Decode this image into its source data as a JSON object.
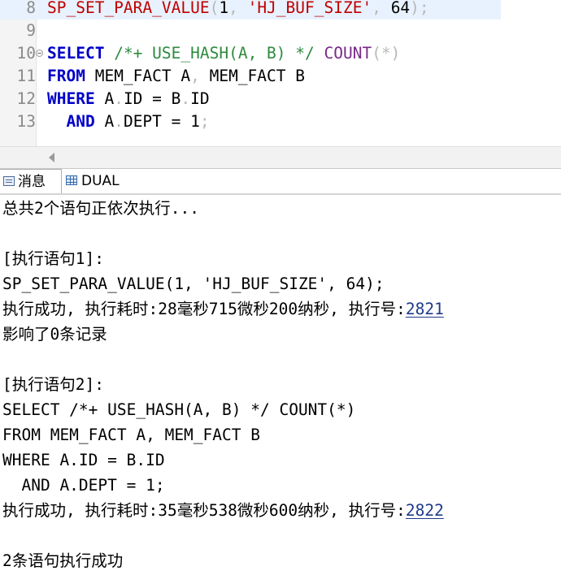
{
  "editor": {
    "lines": [
      {
        "number": "8",
        "highlighted": true,
        "tokens": [
          {
            "text": "SP_SET_PARA_VALUE",
            "cls": "str"
          },
          {
            "text": "(",
            "cls": "dim"
          },
          {
            "text": "1",
            "cls": ""
          },
          {
            "text": ", ",
            "cls": "dim"
          },
          {
            "text": "'HJ_BUF_SIZE'",
            "cls": "str"
          },
          {
            "text": ", ",
            "cls": "dim"
          },
          {
            "text": "64",
            "cls": ""
          },
          {
            "text": ");",
            "cls": "dim"
          }
        ]
      },
      {
        "number": "9",
        "tokens": []
      },
      {
        "number": "10",
        "fold": true,
        "tokens": [
          {
            "text": "SELECT",
            "cls": "kw"
          },
          {
            "text": " ",
            "cls": ""
          },
          {
            "text": "/*+ USE_HASH(A, B) */",
            "cls": "cmt"
          },
          {
            "text": " ",
            "cls": ""
          },
          {
            "text": "COUNT",
            "cls": "fn"
          },
          {
            "text": "(*)",
            "cls": "dim"
          }
        ]
      },
      {
        "number": "11",
        "tokens": [
          {
            "text": "FROM",
            "cls": "kw"
          },
          {
            "text": " MEM_FACT A",
            "cls": ""
          },
          {
            "text": ",",
            "cls": "dim"
          },
          {
            "text": " MEM_FACT B",
            "cls": ""
          }
        ]
      },
      {
        "number": "12",
        "tokens": [
          {
            "text": "WHERE",
            "cls": "kw"
          },
          {
            "text": " A",
            "cls": ""
          },
          {
            "text": ".",
            "cls": "dim"
          },
          {
            "text": "ID = B",
            "cls": ""
          },
          {
            "text": ".",
            "cls": "dim"
          },
          {
            "text": "ID",
            "cls": ""
          }
        ]
      },
      {
        "number": "13",
        "tokens": [
          {
            "text": "  ",
            "cls": ""
          },
          {
            "text": "AND",
            "cls": "kw"
          },
          {
            "text": " A",
            "cls": ""
          },
          {
            "text": ".",
            "cls": "dim"
          },
          {
            "text": "DEPT = 1",
            "cls": ""
          },
          {
            "text": ";",
            "cls": "dim"
          }
        ]
      }
    ]
  },
  "tabs": {
    "messages_label": "消息",
    "dual_label": "DUAL"
  },
  "output": {
    "lines": [
      {
        "text": "总共2个语句正依次执行..."
      },
      {
        "text": ""
      },
      {
        "text": "[执行语句1]:"
      },
      {
        "text": "SP_SET_PARA_VALUE(1, 'HJ_BUF_SIZE', 64);"
      },
      {
        "text": "执行成功, 执行耗时:28毫秒715微秒200纳秒, 执行号:",
        "link": "2821"
      },
      {
        "text": "影响了0条记录"
      },
      {
        "text": ""
      },
      {
        "text": "[执行语句2]:"
      },
      {
        "text": "SELECT /*+ USE_HASH(A, B) */ COUNT(*)"
      },
      {
        "text": "FROM MEM_FACT A, MEM_FACT B"
      },
      {
        "text": "WHERE A.ID = B.ID"
      },
      {
        "text": "  AND A.DEPT = 1;"
      },
      {
        "text": "执行成功, 执行耗时:35毫秒538微秒600纳秒, 执行号:",
        "link": "2822"
      },
      {
        "text": ""
      },
      {
        "text": "2条语句执行成功"
      }
    ]
  }
}
